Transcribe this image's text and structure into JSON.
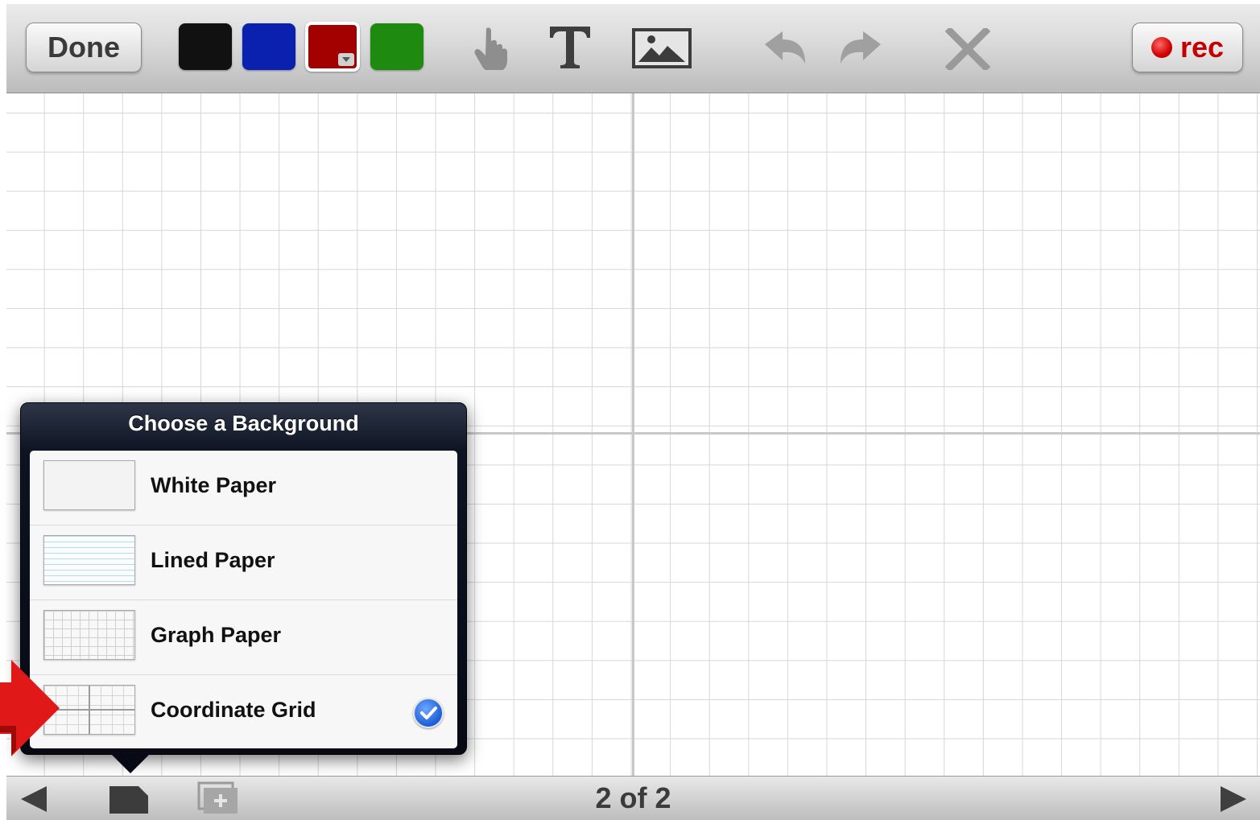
{
  "toolbar": {
    "done_label": "Done",
    "colors": [
      {
        "name": "black",
        "hex": "#111111"
      },
      {
        "name": "blue",
        "hex": "#0a21b0"
      },
      {
        "name": "red",
        "hex": "#a30000",
        "selected": true
      },
      {
        "name": "green",
        "hex": "#1e8a10"
      }
    ],
    "tools": [
      "hand-pointer-icon",
      "text-tool-icon",
      "image-icon",
      "undo-icon",
      "redo-icon",
      "clear-x-icon"
    ],
    "rec_label": "rec"
  },
  "popover": {
    "title": "Choose a Background",
    "options": [
      {
        "label": "White Paper",
        "selected": false
      },
      {
        "label": "Lined Paper",
        "selected": false
      },
      {
        "label": "Graph Paper",
        "selected": false
      },
      {
        "label": "Coordinate Grid",
        "selected": true
      }
    ]
  },
  "bottombar": {
    "page_indicator": "2 of 2",
    "icons": [
      "prev-page-icon",
      "page-background-icon",
      "add-page-icon",
      "next-page-icon"
    ]
  }
}
